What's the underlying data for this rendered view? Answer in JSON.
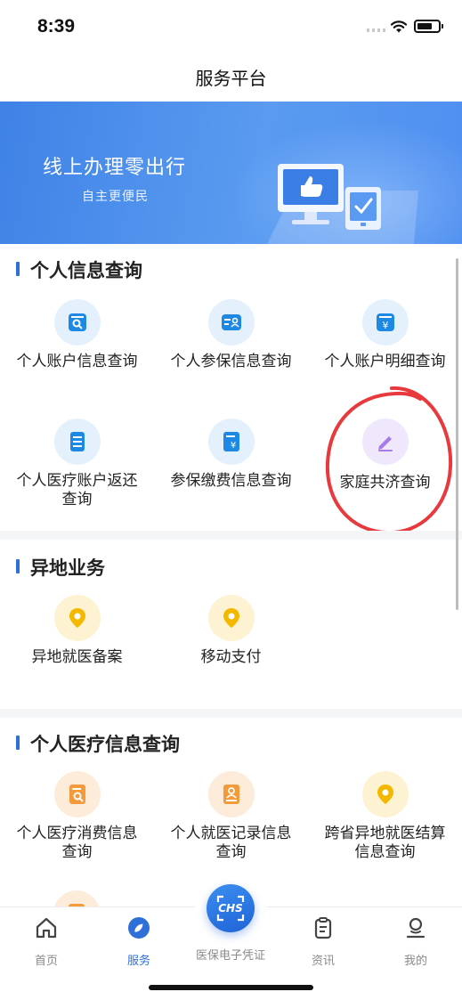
{
  "status_bar": {
    "time": "8:39"
  },
  "header": {
    "title": "服务平台"
  },
  "banner": {
    "title": "线上办理零出行",
    "subtitle": "自主更便民",
    "illustration": "computer-thumbs-up-illustration"
  },
  "sections": [
    {
      "title": "个人信息查询",
      "items": [
        {
          "label": "个人账户信息查询",
          "icon": "search-card-icon",
          "color": "#1e88e5"
        },
        {
          "label": "个人参保信息查询",
          "icon": "id-card-icon",
          "color": "#1e88e5"
        },
        {
          "label": "个人账户明细查询",
          "icon": "yuan-ledger-icon",
          "color": "#1e88e5"
        },
        {
          "label_line1": "个人医疗账户返还",
          "label_line2": "查询",
          "icon": "document-icon",
          "color": "#1e88e5"
        },
        {
          "label": "参保缴费信息查询",
          "icon": "payment-bill-icon",
          "color": "#1e88e5"
        },
        {
          "label": "家庭共济查询",
          "icon": "edit-pen-icon",
          "color": "#a77ce9"
        }
      ]
    },
    {
      "title": "异地业务",
      "items": [
        {
          "label": "异地就医备案",
          "icon": "location-pin-icon",
          "color": "#f5b800"
        },
        {
          "label": "移动支付",
          "icon": "location-pin-icon",
          "color": "#f5b800"
        }
      ]
    },
    {
      "title": "个人医疗信息查询",
      "items": [
        {
          "label_line1": "个人医疗消费信息",
          "label_line2": "查询",
          "icon": "search-document-icon",
          "color": "#f39a3a"
        },
        {
          "label_line1": "个人就医记录信息",
          "label_line2": "查询",
          "icon": "medical-record-icon",
          "color": "#f39a3a"
        },
        {
          "label_line1": "跨省异地就医结算",
          "label_line2": "信息查询",
          "icon": "location-pin-icon",
          "color": "#f5b800"
        }
      ]
    }
  ],
  "tab_bar": {
    "tabs": [
      {
        "label": "首页",
        "icon": "home-icon",
        "active": false
      },
      {
        "label": "服务",
        "icon": "compass-icon",
        "active": true
      },
      {
        "label": "医保电子凭证",
        "icon": "chs-scan-icon",
        "badge": "CHS",
        "active": false
      },
      {
        "label": "资讯",
        "icon": "clipboard-icon",
        "active": false
      },
      {
        "label": "我的",
        "icon": "user-icon",
        "active": false
      }
    ]
  },
  "colors": {
    "accent": "#2f6fd8",
    "banner": "#4a8cec",
    "annotation": "#e8393d"
  }
}
